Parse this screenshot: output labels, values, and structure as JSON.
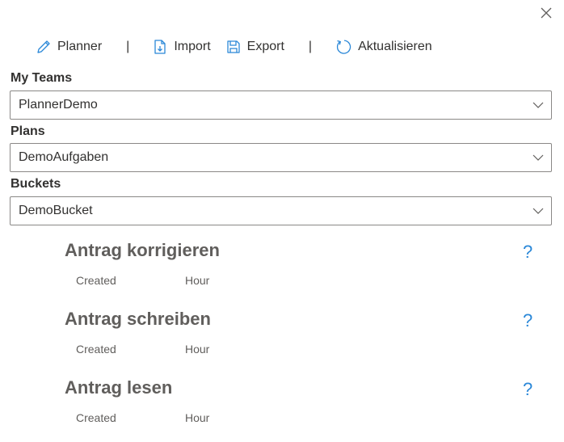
{
  "toolbar": {
    "planner_label": "Planner",
    "separator": "|",
    "import_label": "Import",
    "export_label": "Export",
    "refresh_label": "Aktualisieren"
  },
  "fields": {
    "teams": {
      "label": "My Teams",
      "value": "PlannerDemo"
    },
    "plans": {
      "label": "Plans",
      "value": "DemoAufgaben"
    },
    "buckets": {
      "label": "Buckets",
      "value": "DemoBucket"
    }
  },
  "tasks": [
    {
      "title": "Antrag korrigieren",
      "created_label": "Created",
      "hour_label": "Hour",
      "help": "?"
    },
    {
      "title": "Antrag schreiben",
      "created_label": "Created",
      "hour_label": "Hour",
      "help": "?"
    },
    {
      "title": "Antrag lesen",
      "created_label": "Created",
      "hour_label": "Hour",
      "help": "?"
    }
  ],
  "icons": {
    "close": "close-icon",
    "planner": "pencil-icon",
    "import": "import-icon",
    "export": "export-icon",
    "refresh": "refresh-icon",
    "chevron": "chevron-down-icon"
  },
  "colors": {
    "accent": "#2b88d8",
    "text": "#323130",
    "muted": "#605e5c",
    "border": "#8a8886"
  }
}
